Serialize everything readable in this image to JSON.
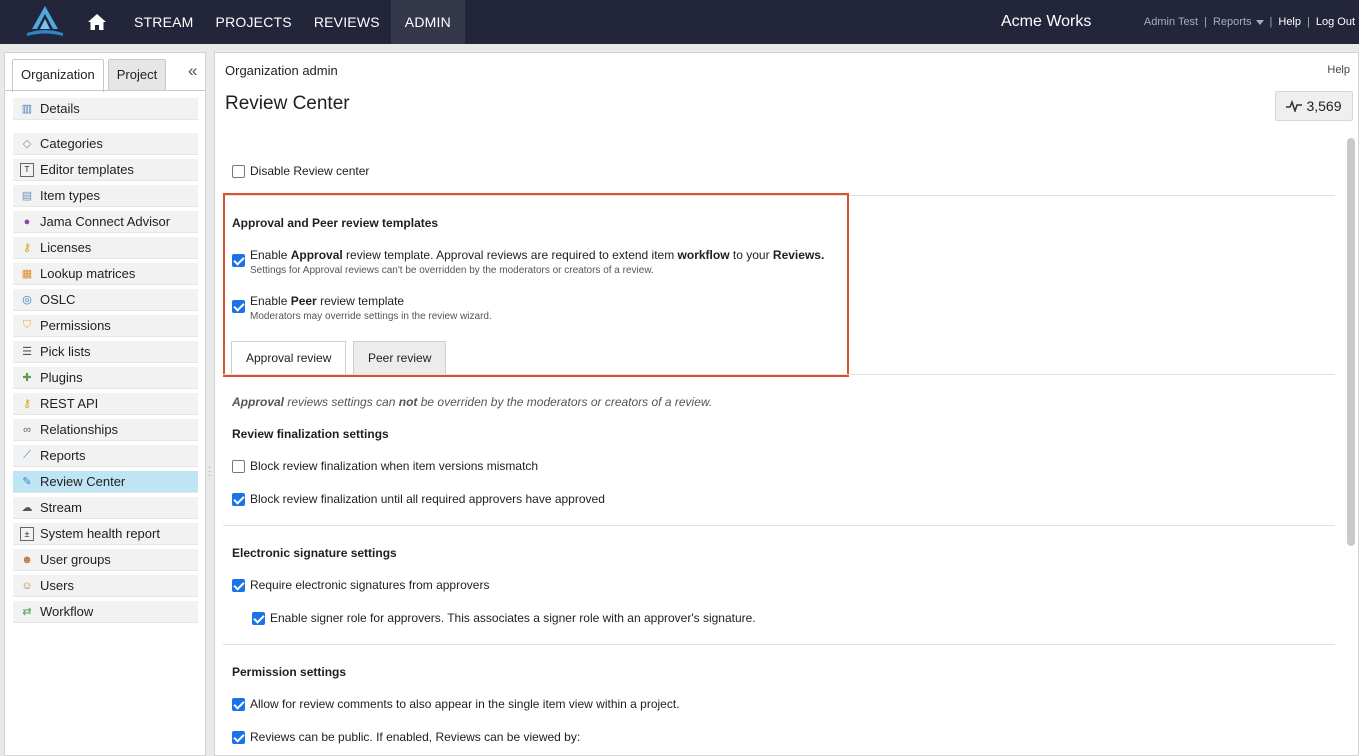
{
  "topbar": {
    "nav": [
      "STREAM",
      "PROJECTS",
      "REVIEWS",
      "ADMIN"
    ],
    "brand": "Acme Works",
    "user": "Admin Test",
    "reports": "Reports",
    "help": "Help",
    "logout": "Log Out"
  },
  "sidebar": {
    "tabs": [
      "Organization",
      "Project"
    ],
    "items": [
      {
        "label": "Details",
        "icon": "building-icon"
      },
      {
        "label": "Categories",
        "icon": "tag-icon"
      },
      {
        "label": "Editor templates",
        "icon": "template-icon"
      },
      {
        "label": "Item types",
        "icon": "item-types-icon"
      },
      {
        "label": "Jama Connect Advisor",
        "icon": "advisor-icon"
      },
      {
        "label": "Licenses",
        "icon": "key-icon"
      },
      {
        "label": "Lookup matrices",
        "icon": "matrix-icon"
      },
      {
        "label": "OSLC",
        "icon": "oslc-icon"
      },
      {
        "label": "Permissions",
        "icon": "shield-icon"
      },
      {
        "label": "Pick lists",
        "icon": "list-icon"
      },
      {
        "label": "Plugins",
        "icon": "puzzle-icon"
      },
      {
        "label": "REST API",
        "icon": "api-key-icon"
      },
      {
        "label": "Relationships",
        "icon": "link-icon"
      },
      {
        "label": "Reports",
        "icon": "chart-icon"
      },
      {
        "label": "Review Center",
        "icon": "review-icon"
      },
      {
        "label": "Stream",
        "icon": "stream-icon"
      },
      {
        "label": "System health report",
        "icon": "health-icon"
      },
      {
        "label": "User groups",
        "icon": "group-icon"
      },
      {
        "label": "Users",
        "icon": "user-icon"
      },
      {
        "label": "Workflow",
        "icon": "workflow-icon"
      }
    ]
  },
  "main": {
    "breadcrumb": "Organization admin",
    "help": "Help",
    "title": "Review Center",
    "activity_count": "3,569",
    "disable_label": "Disable Review center",
    "templates_heading": "Approval and Peer review templates",
    "approval": {
      "pre": "Enable ",
      "b1": "Approval",
      "mid": " review template. Approval reviews are required to extend item ",
      "b2": "workflow",
      "mid2": " to your ",
      "b3": "Reviews.",
      "sub": "Settings for Approval reviews can't be overridden by the moderators or creators of a review."
    },
    "peer": {
      "pre": "Enable ",
      "b1": "Peer",
      "post": " review template",
      "sub": "Moderators may override settings in the review wizard."
    },
    "tab_approval": "Approval review",
    "tab_peer": "Peer review",
    "note": {
      "b1": "Approval",
      "mid": " reviews settings can ",
      "b2": "not",
      "post": " be overriden by the moderators or creators of a review."
    },
    "finalization_heading": "Review finalization settings",
    "final1": "Block review finalization when item versions mismatch",
    "final2": "Block review finalization until all required approvers have approved",
    "esig_heading": "Electronic signature settings",
    "esig1": "Require electronic signatures from approvers",
    "esig2": "Enable signer role for approvers. This associates a signer role with an approver's signature.",
    "perm_heading": "Permission settings",
    "perm1": "Allow for review comments to also appear in the single item view within a project.",
    "perm2": "Reviews can be public. If enabled, Reviews can be viewed by:"
  }
}
